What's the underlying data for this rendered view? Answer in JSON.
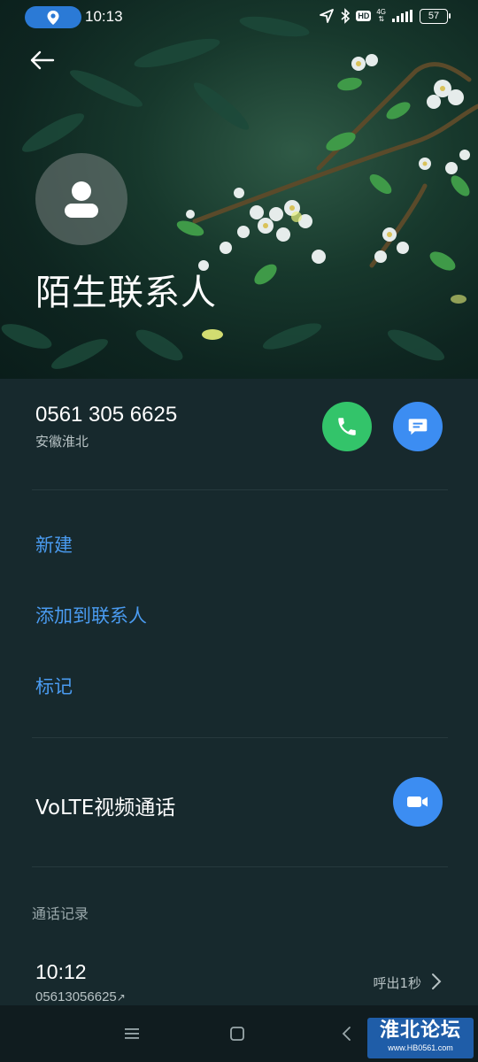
{
  "status_bar": {
    "time": "10:13",
    "network": "4G",
    "hd": "HD",
    "battery": "57"
  },
  "contact": {
    "name": "陌生联系人",
    "phone": "0561 305 6625",
    "location": "安徽淮北"
  },
  "actions": {
    "new": "新建",
    "add_to_contacts": "添加到联系人",
    "mark": "标记"
  },
  "volte": {
    "label": "VoLTE视频通话"
  },
  "call_log": {
    "title": "通话记录",
    "entries": [
      {
        "time": "10:12",
        "number": "05613056625",
        "direction_icon": "↗",
        "status": "呼出1秒"
      }
    ]
  },
  "watermark": {
    "title": "淮北论坛",
    "url": "www.HB0561.com"
  },
  "colors": {
    "background": "#17292d",
    "accent_blue": "#3c8df2",
    "link_blue": "#4a9bf0",
    "call_green": "#33c46a"
  }
}
